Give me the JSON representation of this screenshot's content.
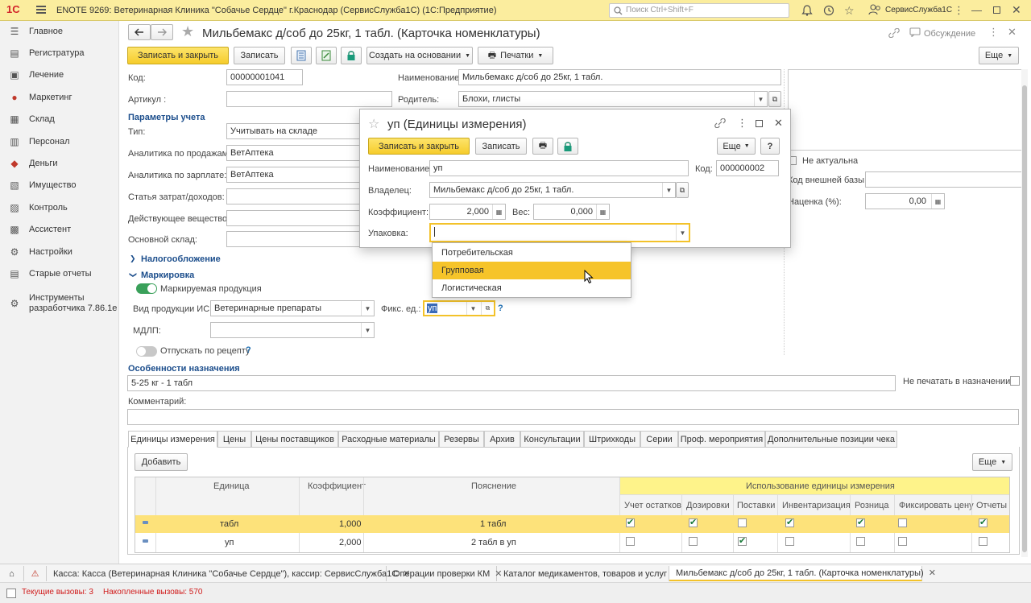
{
  "window": {
    "title": "ENOTE 9269: Ветеринарная Клиника \"Собачье Сердце\" г.Краснодар (СервисСлужба1С)  (1С:Предприятие)",
    "search_placeholder": "Поиск Ctrl+Shift+F",
    "user": "СервисСлужба1С",
    "logo": "1С"
  },
  "sidebar": {
    "items": [
      {
        "label": "Главное",
        "icon": "list-icon"
      },
      {
        "label": "Регистратура",
        "icon": "registry-icon"
      },
      {
        "label": "Лечение",
        "icon": "treatment-icon"
      },
      {
        "label": "Маркетинг",
        "icon": "marketing-icon"
      },
      {
        "label": "Склад",
        "icon": "warehouse-icon"
      },
      {
        "label": "Персонал",
        "icon": "staff-icon"
      },
      {
        "label": "Деньги",
        "icon": "money-icon"
      },
      {
        "label": "Имущество",
        "icon": "property-icon"
      },
      {
        "label": "Контроль",
        "icon": "control-icon"
      },
      {
        "label": "Ассистент",
        "icon": "assistant-icon"
      },
      {
        "label": "Настройки",
        "icon": "settings-icon"
      },
      {
        "label": "Старые отчеты",
        "icon": "reports-icon"
      },
      {
        "label": "Инструменты разработчика 7.86.1е",
        "icon": "dev-tools-icon"
      }
    ]
  },
  "form": {
    "title": "Мильбемакс д/соб до 25кг, 1 табл. (Карточка номенклатуры)",
    "discussion": "Обсуждение",
    "toolbar": {
      "save_close": "Записать и закрыть",
      "save": "Записать",
      "create_based": "Создать на основании",
      "print": "Печатки",
      "more": "Еще"
    },
    "fields": {
      "code_label": "Код:",
      "code_value": "00000001041",
      "name_label": "Наименование:",
      "name_value": "Мильбемакс д/соб до 25кг, 1 табл.",
      "article_label": "Артикул :",
      "article_value": "",
      "parent_label": "Родитель:",
      "parent_value": "Блохи, глисты"
    },
    "accounting": {
      "section": "Параметры учета",
      "type_label": "Тип:",
      "type_value": "Учитывать на складе",
      "sales_label": "Аналитика по продажам:",
      "sales_value": "ВетАптека",
      "salary_label": "Аналитика по зарплате:",
      "salary_value": "ВетАптека",
      "cost_label": "Статья затрат/доходов:",
      "cost_value": "",
      "substance_label": "Действующее вещество:",
      "substance_value": "",
      "warehouse_label": "Основной склад:",
      "warehouse_value": ""
    },
    "right": {
      "not_actual": "Не актуальна",
      "ext_code_label": "Код внешней базы:",
      "ext_code_value": "",
      "markup_label": "Наценка (%):",
      "markup_value": "0,00"
    },
    "taxation": "Налогообложение",
    "marking": {
      "section": "Маркировка",
      "marked": "Маркируемая продукция",
      "marked_on": true,
      "product_type_label": "Вид продукции ИС:",
      "product_type_value": "Ветеринарные препараты",
      "fixed_unit_label": "Фикс. ед.:",
      "fixed_unit_value": "уп",
      "mdlp_label": "МДЛП:",
      "mdlp_value": "",
      "prescription": "Отпускать по рецепту",
      "prescription_on": false,
      "help": "?"
    },
    "purpose": {
      "section": "Особенности назначения",
      "value": "5-25 кг - 1 табл",
      "no_print": "Не печатать в назначении:",
      "comment_label": "Комментарий:",
      "comment_value": ""
    },
    "tabs": [
      "Единицы измерения",
      "Цены",
      "Цены поставщиков",
      "Расходные материалы",
      "Резервы",
      "Архив",
      "Консультации",
      "Штрихкоды",
      "Серии",
      "Проф. мероприятия",
      "Дополнительные позиции чека"
    ],
    "units": {
      "add": "Добавить",
      "more": "Еще",
      "headers": {
        "unit": "Единица",
        "coef": "Коэффициент",
        "note": "Пояснение",
        "usage": "Использование единицы измерения"
      },
      "usage_cols": [
        "Учет остатков",
        "Дозировки",
        "Поставки",
        "Инвентаризация",
        "Розница",
        "Фиксировать цену",
        "Отчеты"
      ],
      "rows": [
        {
          "unit": "табл",
          "coef": "1,000",
          "note": "1 табл",
          "checks": [
            true,
            true,
            false,
            true,
            true,
            false,
            true
          ]
        },
        {
          "unit": "уп",
          "coef": "2,000",
          "note": "2 табл в уп",
          "checks": [
            false,
            false,
            true,
            false,
            false,
            false,
            false
          ]
        }
      ]
    }
  },
  "dialog": {
    "title": "уп (Единицы измерения)",
    "save_close": "Записать и закрыть",
    "save": "Записать",
    "more": "Еще",
    "help": "?",
    "name_label": "Наименование:",
    "name_value": "уп",
    "code_label": "Код:",
    "code_value": "000000002",
    "owner_label": "Владелец:",
    "owner_value": "Мильбемакс д/соб до 25кг, 1 табл.",
    "coef_label": "Коэффициент:",
    "coef_value": "2,000",
    "weight_label": "Вес:",
    "weight_value": "0,000",
    "package_label": "Упаковка:",
    "package_value": "",
    "options": [
      "Потребительская",
      "Групповая",
      "Логистическая"
    ],
    "highlighted_option": "Групповая"
  },
  "bottom_tabs": [
    "Касса: Касса (Ветеринарная Клиника \"Собачье Сердце\"), кассир: СервисСлужба1С",
    "Операции проверки КМ",
    "Каталог медикаментов, товаров и услуг",
    "Мильбемакс д/соб до 25кг, 1 табл. (Карточка номенклатуры)"
  ],
  "status": {
    "current_calls": "Текущие вызовы: 3",
    "accumulated_calls": "Накопленные вызовы: 570"
  },
  "colors": {
    "accent_yellow": "#f6cc2b",
    "title_bar": "#fbed9e",
    "section_blue": "#1c4e8c",
    "toggle_green": "#3aa05a",
    "row_highlight": "#fde27a",
    "status_red": "#d01c1c"
  }
}
